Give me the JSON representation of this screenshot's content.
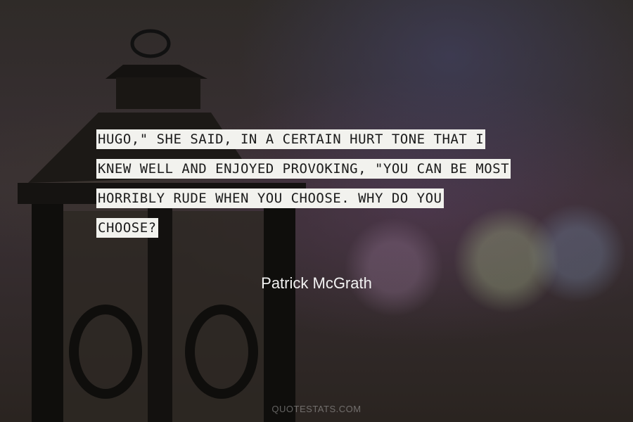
{
  "quote": {
    "lines": [
      "HUGO,\" SHE SAID, IN A CERTAIN HURT TONE THAT I",
      "KNEW WELL AND ENJOYED PROVOKING, \"YOU CAN BE MOST",
      "HORRIBLY RUDE WHEN YOU CHOOSE. WHY DO YOU",
      "CHOOSE?"
    ]
  },
  "author": "Patrick McGrath",
  "watermark": "QUOTESTATS.COM",
  "icons": [
    "lantern-icon"
  ]
}
